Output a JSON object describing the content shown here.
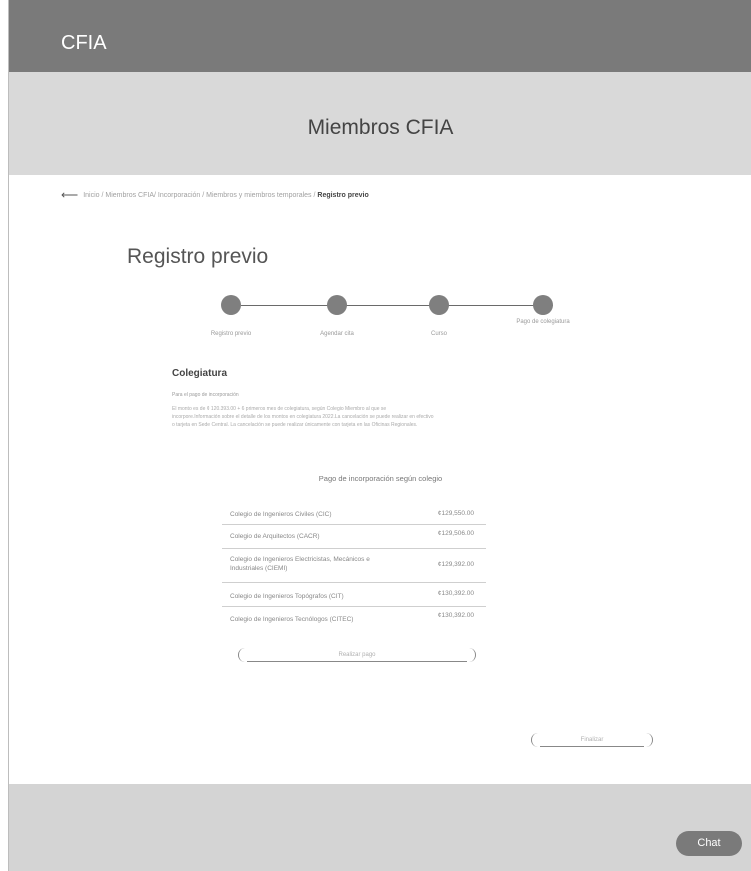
{
  "header": {
    "brand": "CFIA"
  },
  "hero": {
    "title": "Miembros CFIA"
  },
  "breadcrumb": {
    "path": "Inicio / Miembros CFIA/ Incorporación / Miembros y miembros temporales / ",
    "current": "Registro previo"
  },
  "page": {
    "title": "Registro previo"
  },
  "stepper": {
    "steps": [
      {
        "label": "Registro previo"
      },
      {
        "label": "Agendar cita"
      },
      {
        "label": "Curso"
      },
      {
        "label": "Pago de colegiatura"
      }
    ]
  },
  "colegiatura": {
    "title": "Colegiatura",
    "subtitle": "Para el pago de incorporación",
    "paragraph": "El monto es de ¢ 120.393.00 + 6 primeros mes de colegiatura, según Colegio Miembro al que se incorpore.Información sobre el detalle de los montos en colegiatura 2022.La cancelación se puede realizar en efectivo o tarjeta en Sede Central. La cancelación se puede realizar únicamente con tarjeta en las Oficinas Regionales."
  },
  "fees": {
    "title": "Pago de incorporación según colegio",
    "rows": [
      {
        "name": "Colegio de Ingenieros Civiles (CIC)",
        "amount": "¢129,550.00"
      },
      {
        "name": "Colegio de Arquitectos (CACR)",
        "amount": "¢129,506.00"
      },
      {
        "name": "Colegio de Ingenieros Electricistas, Mecánicos e Industriales (CIEMI)",
        "amount": "¢129,392.00"
      },
      {
        "name": "Colegio de Ingenieros Topógrafos (CIT)",
        "amount": "¢130,392.00"
      },
      {
        "name": "Colegio de Ingenieros Tecnólogos (CITEC)",
        "amount": "¢130,392.00"
      }
    ]
  },
  "actions": {
    "pay_label": "Realizar pago",
    "finish_label": "Finalizar"
  },
  "chat": {
    "label": "Chat"
  }
}
